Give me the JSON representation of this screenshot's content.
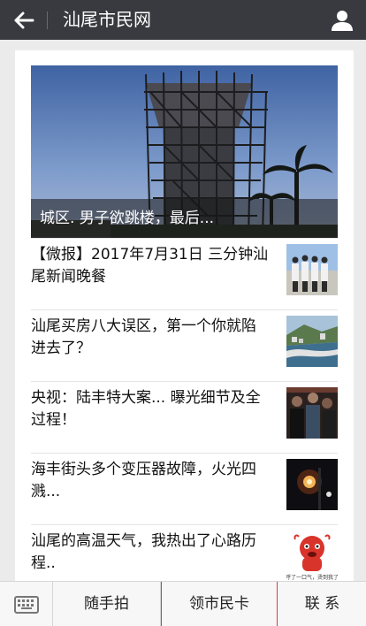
{
  "header": {
    "title": "汕尾市民网",
    "back_icon": "arrow-left-icon",
    "user_icon": "user-icon"
  },
  "hero": {
    "caption": "城区. 男子欲跳楼，最后..."
  },
  "articles": [
    {
      "title": "【微报】2017年7月31日 三分钟汕尾新闻晚餐"
    },
    {
      "title": "汕尾买房八大误区，第一个你就陷进去了？"
    },
    {
      "title": "央视：陆丰特大案... 曝光细节及全过程！"
    },
    {
      "title": "海丰街头多个变压器故障，火光四溅..."
    },
    {
      "title": "汕尾的高温天气，我热出了心路历程.."
    }
  ],
  "thumb_caption": "呼了一口气，烫到我了",
  "bottom_nav": {
    "tab1": "随手拍",
    "tab2": "领市民卡",
    "tab3": "联 系"
  }
}
